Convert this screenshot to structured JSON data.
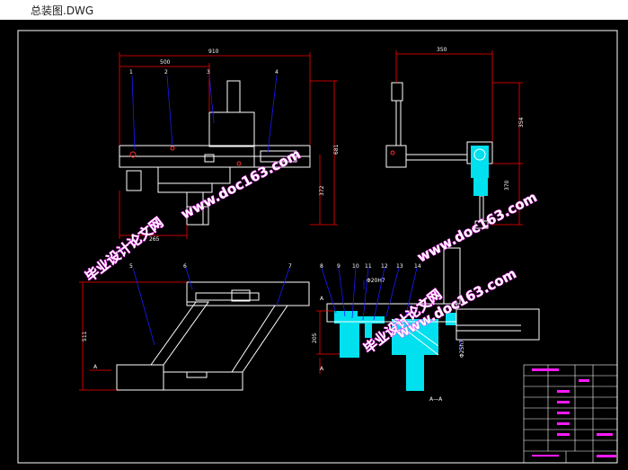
{
  "window": {
    "title": "总装图.DWG"
  },
  "drawing": {
    "dimensions": {
      "front_width": "910",
      "front_inner": "500",
      "front_height": "681",
      "front_lower": "372",
      "front_bottom": "265",
      "side_width": "350",
      "side_upper": "354",
      "side_lower": "370",
      "plan_height": "511",
      "section_height": "205",
      "hole_top": "Φ20H7",
      "hole_side": "Φ25h7"
    },
    "part_numbers": [
      "1",
      "2",
      "3",
      "4",
      "5",
      "6",
      "7",
      "8",
      "9",
      "10",
      "11",
      "12",
      "13",
      "14"
    ],
    "section_marks": {
      "a": "A",
      "a2": "A",
      "a3": "A",
      "section": "A—A"
    }
  },
  "watermarks": {
    "site_1": "www.doc163.com",
    "site_2": "毕业设计论文网",
    "site_3": "www.doc163.com",
    "site_4": "毕业设计论文网",
    "site_5": "www.doc163.com"
  },
  "colors": {
    "background": "#000000",
    "line": "#ffffff",
    "dimension": "#ff0000",
    "leader": "#1a1aff",
    "section_fill": "#00e0ee",
    "watermark_stroke": "#ff1aff"
  }
}
